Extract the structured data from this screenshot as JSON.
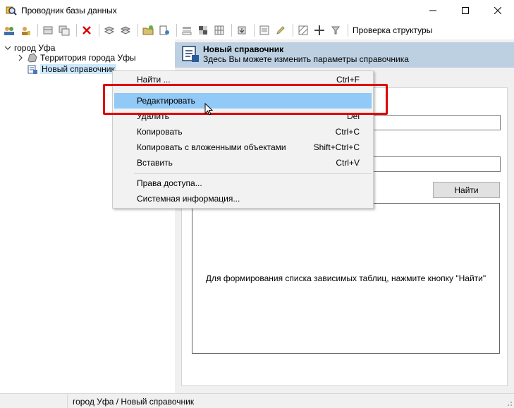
{
  "window": {
    "title": "Проводник базы данных",
    "app_icon": "magnifier-db-icon"
  },
  "toolbar": {
    "structure_check_label": "Проверка структуры"
  },
  "tree": {
    "root_label": "город Уфа",
    "children": [
      {
        "label": "Территория города Уфы"
      },
      {
        "label": "Новый справочник"
      }
    ]
  },
  "panel": {
    "title": "Новый справочник",
    "subtitle": "Здесь Вы можете изменить параметры справочника",
    "find_button": "Найти",
    "deps_hint": "Для формирования списка зависимых таблиц, нажмите кнопку \"Найти\""
  },
  "context_menu": {
    "items": [
      {
        "label": "Найти ...",
        "shortcut": "Ctrl+F"
      },
      {
        "label": "Редактировать",
        "shortcut": ""
      },
      {
        "label": "Удалить",
        "shortcut": "Del"
      },
      {
        "label": "Копировать",
        "shortcut": "Ctrl+C"
      },
      {
        "label": "Копировать с вложенными объектами",
        "shortcut": "Shift+Ctrl+C"
      },
      {
        "label": "Вставить",
        "shortcut": "Ctrl+V"
      },
      {
        "label": "Права доступа...",
        "shortcut": ""
      },
      {
        "label": "Системная информация...",
        "shortcut": ""
      }
    ],
    "highlighted_index": 1
  },
  "statusbar": {
    "path": "город Уфа / Новый справочник"
  },
  "colors": {
    "header_bg": "#bdd0e2",
    "menu_highlight": "#91c9f7",
    "annotation_red": "#e00000",
    "tree_selected": "#cce8ff"
  }
}
